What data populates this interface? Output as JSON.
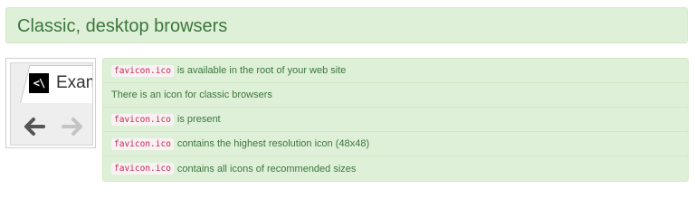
{
  "section": {
    "title": "Classic, desktop browsers"
  },
  "preview": {
    "favicon_glyph": "<\\",
    "tab_title": "Exam",
    "back_icon": "arrow-left",
    "forward_icon": "arrow-right"
  },
  "checks": [
    {
      "code": "favicon.ico",
      "text": "is available in the root of your web site"
    },
    {
      "code": "",
      "text": "There is an icon for classic browsers"
    },
    {
      "code": "favicon.ico",
      "text": "is present"
    },
    {
      "code": "favicon.ico",
      "text": "contains the highest resolution icon (48x48)"
    },
    {
      "code": "favicon.ico",
      "text": "contains all icons of recommended sizes"
    }
  ],
  "colors": {
    "success_bg": "#dff0d8",
    "success_border": "#d0e6c3",
    "success_text": "#3c763d",
    "code_text": "#c7254e",
    "code_bg": "#f9f2f4"
  }
}
